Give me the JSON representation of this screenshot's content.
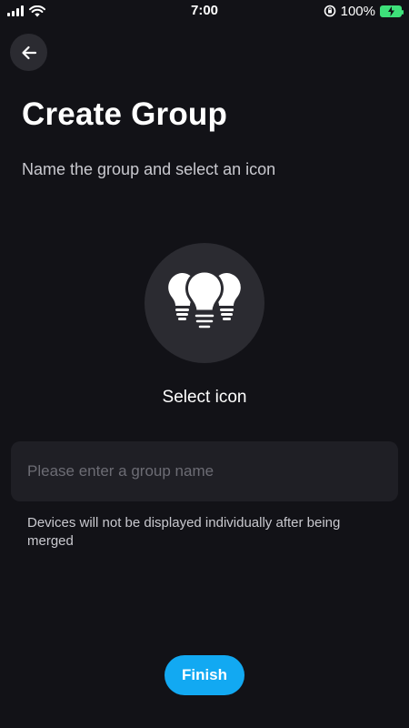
{
  "status_bar": {
    "time": "7:00",
    "battery_percent": "100%",
    "icons": [
      "signal-icon",
      "wifi-icon",
      "orientation-lock-icon",
      "battery-charging-icon"
    ]
  },
  "header": {
    "back_icon": "arrow-left-icon",
    "title": "Create Group",
    "subtitle": "Name the group and select an icon"
  },
  "icon_picker": {
    "icon": "light-bulbs-icon",
    "label": "Select icon"
  },
  "form": {
    "group_name_value": "",
    "group_name_placeholder": "Please enter a group name",
    "note": "Devices will not be displayed individually after being merged"
  },
  "actions": {
    "finish_label": "Finish"
  },
  "colors": {
    "background": "#121217",
    "surface": "#2b2b31",
    "input_bg": "#1f1f25",
    "accent": "#12a9f2",
    "battery": "#3ee07a"
  }
}
